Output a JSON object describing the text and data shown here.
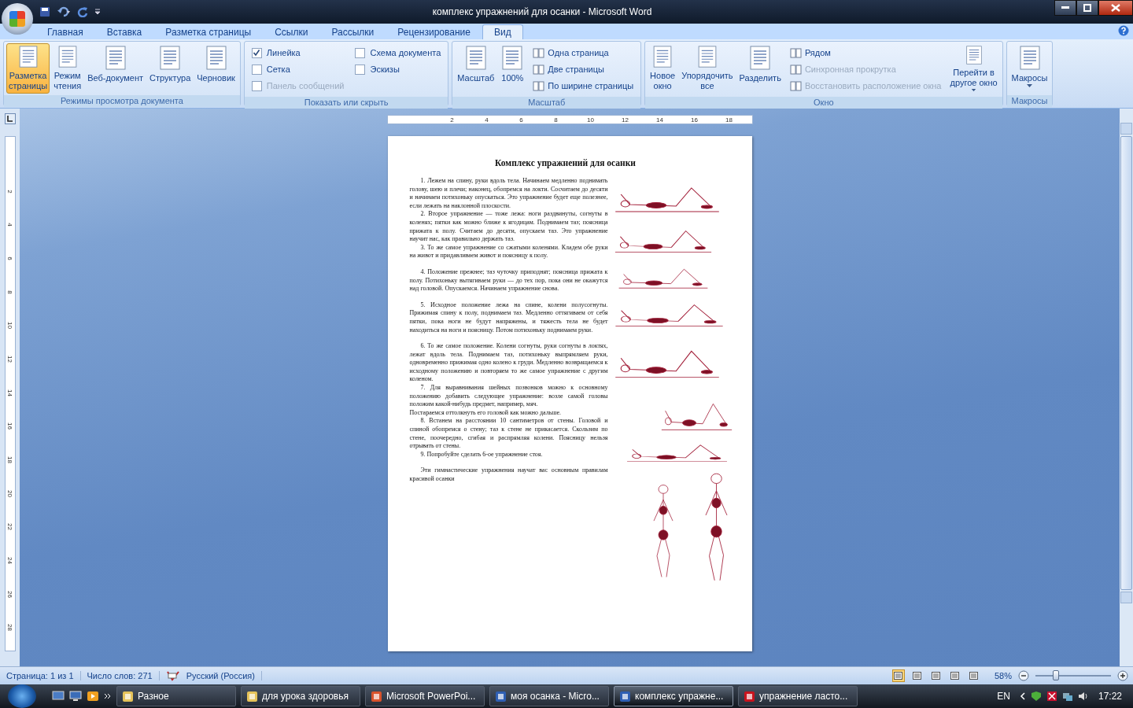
{
  "window": {
    "title": "комплекс упражнений для осанки - Microsoft Word"
  },
  "tabs": [
    {
      "label": "Главная",
      "selected": false
    },
    {
      "label": "Вставка",
      "selected": false
    },
    {
      "label": "Разметка страницы",
      "selected": false
    },
    {
      "label": "Ссылки",
      "selected": false
    },
    {
      "label": "Рассылки",
      "selected": false
    },
    {
      "label": "Рецензирование",
      "selected": false
    },
    {
      "label": "Вид",
      "selected": true
    }
  ],
  "ribbon_groups": [
    {
      "label": "Режимы просмотра документа",
      "columns": [
        [
          {
            "kind": "large",
            "label": "Разметка\nстраницы",
            "selected": true
          }
        ],
        [
          {
            "kind": "large",
            "label": "Режим\nчтения",
            "selected": false
          }
        ],
        [
          {
            "kind": "large",
            "label": "Веб-документ",
            "selected": false
          }
        ],
        [
          {
            "kind": "large",
            "label": "Структура",
            "selected": false
          }
        ],
        [
          {
            "kind": "large",
            "label": "Черновик",
            "selected": false
          }
        ]
      ]
    },
    {
      "label": "Показать или скрыть",
      "columns": [
        [
          {
            "kind": "check",
            "label": "Линейка",
            "checked": true,
            "disabled": false
          },
          {
            "kind": "check",
            "label": "Сетка",
            "checked": false,
            "disabled": false
          },
          {
            "kind": "check",
            "label": "Панель сообщений",
            "checked": false,
            "disabled": true
          }
        ],
        [
          {
            "kind": "check",
            "label": "Схема документа",
            "checked": false,
            "disabled": false
          },
          {
            "kind": "check",
            "label": "Эскизы",
            "checked": false,
            "disabled": false
          }
        ]
      ]
    },
    {
      "label": "Масштаб",
      "columns": [
        [
          {
            "kind": "large",
            "label": "Масштаб",
            "selected": false
          }
        ],
        [
          {
            "kind": "large",
            "label": "100%",
            "selected": false
          }
        ],
        [
          {
            "kind": "small",
            "label": "Одна страница",
            "disabled": false
          },
          {
            "kind": "small",
            "label": "Две страницы",
            "disabled": false
          },
          {
            "kind": "small",
            "label": "По ширине страницы",
            "disabled": false
          }
        ]
      ]
    },
    {
      "label": "Окно",
      "columns": [
        [
          {
            "kind": "large",
            "label": "Новое\nокно",
            "selected": false
          }
        ],
        [
          {
            "kind": "large",
            "label": "Упорядочить\nвсе",
            "selected": false
          }
        ],
        [
          {
            "kind": "large",
            "label": "Разделить",
            "selected": false
          }
        ],
        [
          {
            "kind": "small",
            "label": "Рядом",
            "disabled": false
          },
          {
            "kind": "small",
            "label": "Синхронная прокрутка",
            "disabled": true
          },
          {
            "kind": "small",
            "label": "Восстановить расположение окна",
            "disabled": true
          }
        ],
        [
          {
            "kind": "large",
            "label": "Перейти в\nдругое окно",
            "selected": false,
            "dropdown": true
          }
        ]
      ]
    },
    {
      "label": "Макросы",
      "columns": [
        [
          {
            "kind": "large",
            "label": "Макросы",
            "selected": false,
            "dropdown": true
          }
        ]
      ]
    }
  ],
  "ruler": {
    "horizontal": [
      "2",
      "4",
      "6",
      "8",
      "10",
      "12",
      "14",
      "16",
      "18"
    ],
    "vertical": [
      "2",
      "4",
      "6",
      "8",
      "10",
      "12",
      "14",
      "16",
      "18",
      "20",
      "22",
      "24",
      "26",
      "28"
    ]
  },
  "document": {
    "title": "Комплекс упражнений для осанки",
    "paragraphs": [
      {
        "text": "1. Лежем на спину, руки вдоль тела. Начинаем медленно поднимать голову, шею и плечи; наконец, обопремся на локти. Сосчитаем до десяти и начинаем потихоньку опускаться. Это упражнение будет еще полезнее, если лежать на наклонной плоскости.",
        "indent": true,
        "space_before": false
      },
      {
        "text": "2. Второе упражнение — тоже лежа: ноги раздвинуты, согнуты в коленях; пятки как можно ближе к ягодицам. Поднимаем таз; поясница прижата к полу. Считаем до десяти, опускаем таз. Это упражнение научит нас, как правильно держать таз.",
        "indent": true,
        "space_before": false
      },
      {
        "text": "3. То же самое упражнение со сжатыми коленями. Кладем обе руки на живот и придавливаем живот и поясницу к полу.",
        "indent": true,
        "space_before": false
      },
      {
        "text": "4. Положение прежнее; таз чуточку приподнят; поясница прижата к полу. Потихоньку вытягиваем руки — до тех пор, пока они не окажутся над головой. Опускаемся. Начинаем упражнение снова.",
        "indent": true,
        "space_before": true
      },
      {
        "text": "5. Исходное положение лежа на спине, колени полусогнуты. Прижимая спину к полу, поднимаем таз. Медленно оттягиваем от себя пятки, пока ноги не будут напряжены, и тяжесть тела не будет находиться на ноги и поясницу. Потом потихоньку поднимаем руки.",
        "indent": true,
        "space_before": true
      },
      {
        "text": "6. То же самое положение. Колени согнуты, руки согнуты в локтях, лежат вдоль тела. Поднимаем таз, потихоньку выпрямляем руки, одновременно прижимая одно колено к груди. Медленно возвращаемся к исходному положению и повторяем то же самое упражнение с другим коленом.",
        "indent": true,
        "space_before": true
      },
      {
        "text": "7. Для выравнивания шейных позвонков можно к основному положению добавить следующее упражнение: возле самой головы положим какой-нибудь предмет, например, мяч.",
        "indent": true,
        "space_before": false
      },
      {
        "text": "Постараемся оттолкнуть его головой как можно дальше.",
        "indent": false,
        "space_before": false
      },
      {
        "text": "8. Встанем на расстоянии 10 сантиметров от стены. Головой и спиной обопремся о стену; таз к стене не прикасается. Скользим по стене, поочередно, сгибая и распрямляя колени. Поясницу нельзя отрывать от стены.",
        "indent": true,
        "space_before": false
      },
      {
        "text": "9. Попробуйте сделать 6-ое упражнение стоя.",
        "indent": true,
        "space_before": false
      },
      {
        "text": "Эти гимнастические упражнения научат вас основным правилам красивой осанки",
        "indent": true,
        "space_before": true
      }
    ]
  },
  "status_bar": {
    "items": [
      "Страница: 1 из 1",
      "Число слов: 271"
    ],
    "language": "Русский (Россия)",
    "views": [
      {
        "selected": true
      },
      {
        "selected": false
      },
      {
        "selected": false
      },
      {
        "selected": false
      },
      {
        "selected": false
      }
    ],
    "zoom": "58%",
    "zoom_slider": {
      "level": 0.27
    }
  },
  "taskbar": {
    "tasks": [
      {
        "label": "Разное",
        "selected": false
      },
      {
        "label": "для урока здоровья",
        "selected": false
      },
      {
        "label": "Microsoft PowerPoi...",
        "selected": false
      },
      {
        "label": "моя осанка - Micro...",
        "selected": false
      },
      {
        "label": "комплекс упражне...",
        "selected": true
      },
      {
        "label": "упражнение ласто...",
        "selected": false
      }
    ],
    "language": "EN",
    "clock": "17:22"
  }
}
